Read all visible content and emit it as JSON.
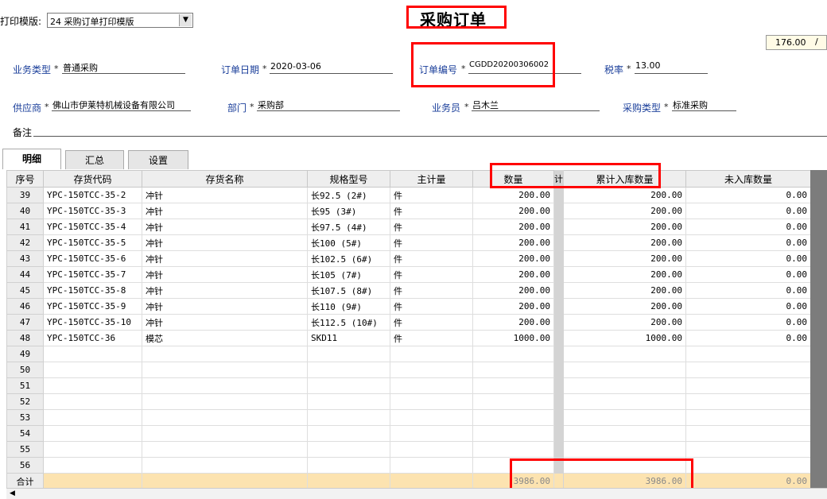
{
  "template": {
    "label": "打印模版:",
    "value": "24 采购订单打印模版"
  },
  "title": "采购订单",
  "page_value": "176.00",
  "page_slash": "/",
  "fields": {
    "biz_type": {
      "label": "业务类型",
      "value": "普通采购"
    },
    "order_date": {
      "label": "订单日期",
      "value": "2020-03-06"
    },
    "order_no": {
      "label": "订单编号",
      "value": "CGDD20200306002"
    },
    "tax_rate": {
      "label": "税率",
      "value": "13.00"
    },
    "supplier": {
      "label": "供应商",
      "value": "佛山市伊莱特机械设备有限公司"
    },
    "dept": {
      "label": "部门",
      "value": "采购部"
    },
    "salesman": {
      "label": "业务员",
      "value": "吕木兰"
    },
    "purchase_type": {
      "label": "采购类型",
      "value": "标准采购"
    },
    "remark": {
      "label": "备注",
      "value": ""
    }
  },
  "required_mark": "*",
  "tabs": [
    "明细",
    "汇总",
    "设置"
  ],
  "table": {
    "headers": [
      "序号",
      "存货代码",
      "存货名称",
      "规格型号",
      "主计量",
      "数量",
      "计",
      "累计入库数量",
      "未入库数量"
    ],
    "rows": [
      [
        "39",
        "YPC-150TCC-35-2",
        "冲针",
        "长92.5 (2#)",
        "件",
        "200.00",
        "200.00",
        "0.00"
      ],
      [
        "40",
        "YPC-150TCC-35-3",
        "冲针",
        "长95 (3#)",
        "件",
        "200.00",
        "200.00",
        "0.00"
      ],
      [
        "41",
        "YPC-150TCC-35-4",
        "冲针",
        "长97.5 (4#)",
        "件",
        "200.00",
        "200.00",
        "0.00"
      ],
      [
        "42",
        "YPC-150TCC-35-5",
        "冲针",
        "长100 (5#)",
        "件",
        "200.00",
        "200.00",
        "0.00"
      ],
      [
        "43",
        "YPC-150TCC-35-6",
        "冲针",
        "长102.5 (6#)",
        "件",
        "200.00",
        "200.00",
        "0.00"
      ],
      [
        "44",
        "YPC-150TCC-35-7",
        "冲针",
        "长105 (7#)",
        "件",
        "200.00",
        "200.00",
        "0.00"
      ],
      [
        "45",
        "YPC-150TCC-35-8",
        "冲针",
        "长107.5 (8#)",
        "件",
        "200.00",
        "200.00",
        "0.00"
      ],
      [
        "46",
        "YPC-150TCC-35-9",
        "冲针",
        "长110 (9#)",
        "件",
        "200.00",
        "200.00",
        "0.00"
      ],
      [
        "47",
        "YPC-150TCC-35-10",
        "冲针",
        "长112.5 (10#)",
        "件",
        "200.00",
        "200.00",
        "0.00"
      ],
      [
        "48",
        "YPC-150TCC-36",
        "模芯",
        "SKD11",
        "件",
        "1000.00",
        "1000.00",
        "0.00"
      ],
      [
        "49",
        "",
        "",
        "",
        "",
        "",
        "",
        ""
      ],
      [
        "50",
        "",
        "",
        "",
        "",
        "",
        "",
        ""
      ],
      [
        "51",
        "",
        "",
        "",
        "",
        "",
        "",
        ""
      ],
      [
        "52",
        "",
        "",
        "",
        "",
        "",
        "",
        ""
      ],
      [
        "53",
        "",
        "",
        "",
        "",
        "",
        "",
        ""
      ],
      [
        "54",
        "",
        "",
        "",
        "",
        "",
        "",
        ""
      ],
      [
        "55",
        "",
        "",
        "",
        "",
        "",
        "",
        ""
      ],
      [
        "56",
        "",
        "",
        "",
        "",
        "",
        "",
        ""
      ]
    ],
    "total": {
      "label": "合计",
      "qty": "3986.00",
      "received": "3986.00",
      "pending": "0.00"
    }
  },
  "colors": {
    "highlight": "#ff0000",
    "label": "#1a3e9a",
    "total_row": "#fce3b0"
  }
}
